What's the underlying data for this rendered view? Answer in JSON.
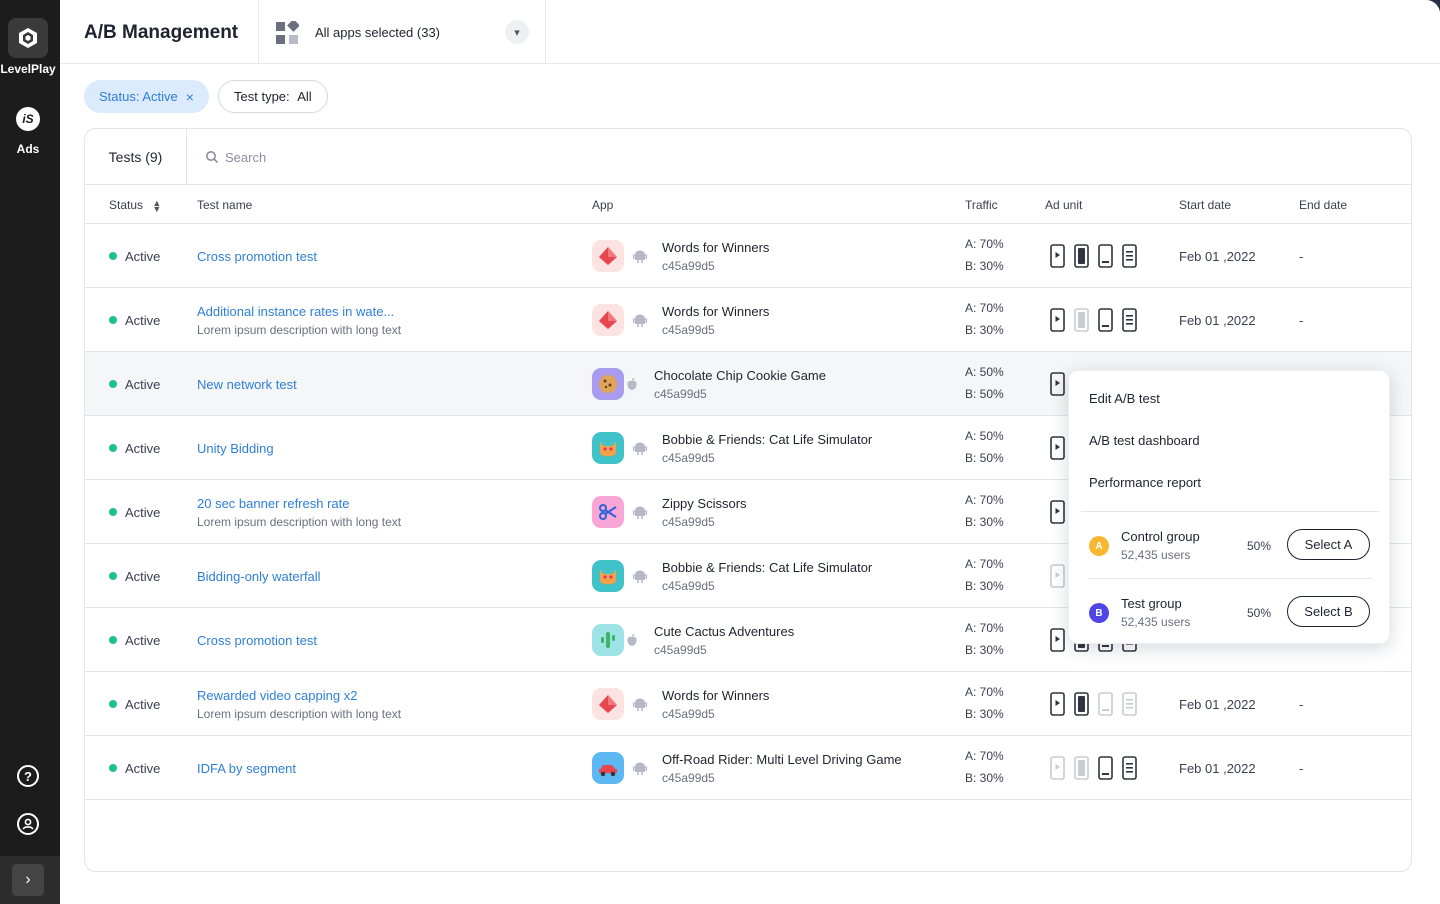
{
  "sidebar": {
    "brand_label": "LevelPlay",
    "ads_label": "Ads",
    "ads_icon_text": "iS"
  },
  "header": {
    "title": "A/B Management",
    "app_selector_label": "All apps selected (33)"
  },
  "filters": {
    "status_label": "Status: Active",
    "status_clear": "×",
    "test_type_label": "Test type: ",
    "test_type_value": "All"
  },
  "table": {
    "tab_label": "Tests (9)",
    "search_placeholder": "Search",
    "columns": {
      "status": "Status",
      "test_name": "Test name",
      "app": "App",
      "traffic": "Traffic",
      "ad_unit": "Ad unit",
      "start_date": "Start date",
      "end_date": "End date"
    },
    "rows": [
      {
        "status": "Active",
        "name": "Cross promotion test",
        "desc": "",
        "app": "Words for Winners",
        "app_id": "c45a99d5",
        "app_icon": "gem-icon",
        "traffic_a": "A: 70%",
        "traffic_b": "B: 30%",
        "start": "Feb 01 ,2022",
        "end": "-",
        "platform": "android",
        "adunits": [
          true,
          true,
          true,
          true
        ]
      },
      {
        "status": "Active",
        "name": "Additional instance rates in wate...",
        "desc": "Lorem ipsum description with long text",
        "app": "Words for Winners",
        "app_id": "c45a99d5",
        "app_icon": "gem-icon",
        "traffic_a": "A: 70%",
        "traffic_b": "B: 30%",
        "start": "Feb 01 ,2022",
        "end": "-",
        "platform": "android",
        "adunits": [
          true,
          false,
          true,
          true
        ]
      },
      {
        "status": "Active",
        "name": "New network test",
        "desc": "",
        "app": "Chocolate Chip Cookie Game",
        "app_id": "c45a99d5",
        "app_icon": "cookie-icon",
        "traffic_a": "A: 50%",
        "traffic_b": "B: 50%",
        "start": "",
        "end": "",
        "platform": "apple",
        "adunits": [
          true
        ]
      },
      {
        "status": "Active",
        "name": "Unity Bidding",
        "desc": "",
        "app": "Bobbie & Friends: Cat Life Simulator",
        "app_id": "c45a99d5",
        "app_icon": "cat-icon",
        "traffic_a": "A: 50%",
        "traffic_b": "B: 50%",
        "start": "",
        "end": "",
        "platform": "android",
        "adunits": [
          true
        ]
      },
      {
        "status": "Active",
        "name": "20 sec banner refresh rate",
        "desc": "Lorem ipsum description with long text",
        "app": "Zippy Scissors",
        "app_id": "c45a99d5",
        "app_icon": "scissors-icon",
        "traffic_a": "A: 70%",
        "traffic_b": "B: 30%",
        "start": "",
        "end": "",
        "platform": "android",
        "adunits": [
          true
        ]
      },
      {
        "status": "Active",
        "name": "Bidding-only waterfall",
        "desc": "",
        "app": "Bobbie & Friends: Cat Life Simulator",
        "app_id": "c45a99d5",
        "app_icon": "cat-icon",
        "traffic_a": "A: 70%",
        "traffic_b": "B: 30%",
        "start": "",
        "end": "",
        "platform": "android",
        "adunits": [
          false
        ]
      },
      {
        "status": "Active",
        "name": "Cross promotion test",
        "desc": "",
        "app": "Cute Cactus Adventures",
        "app_id": "c45a99d5",
        "app_icon": "cactus-icon",
        "traffic_a": "A: 70%",
        "traffic_b": "B: 30%",
        "start": "",
        "end": "",
        "platform": "apple",
        "adunits": [
          true,
          true,
          true,
          true
        ]
      },
      {
        "status": "Active",
        "name": "Rewarded video capping x2",
        "desc": "Lorem ipsum description with long text",
        "app": "Words for Winners",
        "app_id": "c45a99d5",
        "app_icon": "gem-icon",
        "traffic_a": "A: 70%",
        "traffic_b": "B: 30%",
        "start": "Feb 01 ,2022",
        "end": "-",
        "platform": "android",
        "adunits": [
          true,
          true,
          false,
          false
        ]
      },
      {
        "status": "Active",
        "name": "IDFA by segment",
        "desc": "",
        "app": "Off-Road Rider: Multi Level Driving Game",
        "app_id": "c45a99d5",
        "app_icon": "car-icon",
        "traffic_a": "A: 70%",
        "traffic_b": "B: 30%",
        "start": "Feb 01 ,2022",
        "end": "-",
        "platform": "android",
        "adunits": [
          false,
          false,
          true,
          true
        ]
      }
    ]
  },
  "popup": {
    "menu": [
      "Edit A/B test",
      "A/B test dashboard",
      "Performance report"
    ],
    "groups": [
      {
        "badge": "A",
        "name": "Control group",
        "users": "52,435 users",
        "pct": "50%",
        "button": "Select A",
        "color": "#f7b731"
      },
      {
        "badge": "B",
        "name": "Test group",
        "users": "52,435 users",
        "pct": "50%",
        "button": "Select B",
        "color": "#4f46e5"
      }
    ]
  },
  "colors": {
    "link": "#2e7fd8",
    "active_dot": "#1fbf8f",
    "sidebar_bg": "#1c1c1c"
  }
}
